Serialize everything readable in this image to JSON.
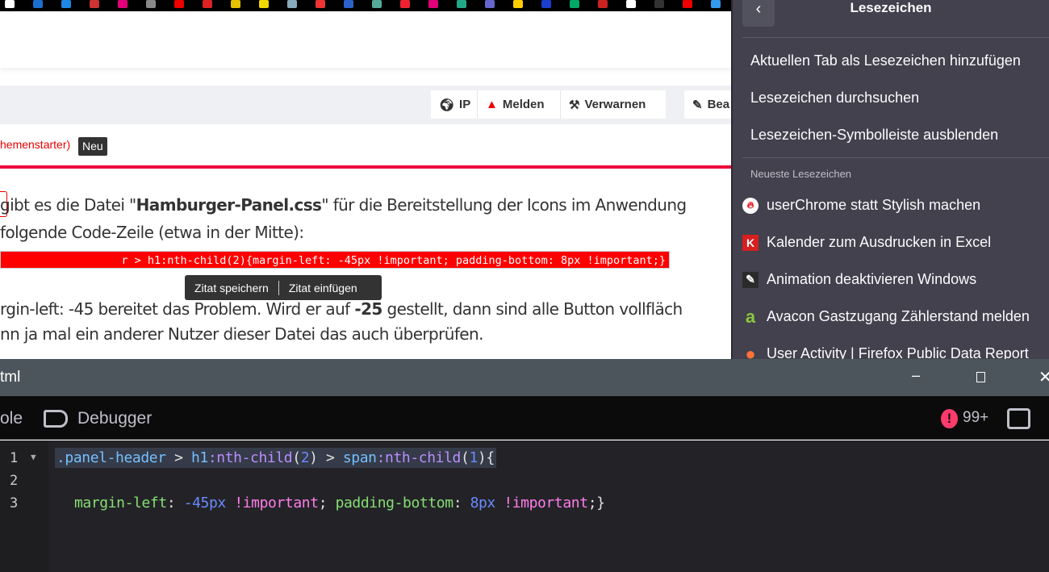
{
  "bookmark_icon_colors": [
    "#fff",
    "#1b6fd1",
    "#1e88e5",
    "#c33",
    "#e2007a",
    "#888",
    "#e00",
    "#d22",
    "#e5c100",
    "#f2d900",
    "#8ab",
    "#e33",
    "#2a62c9",
    "#5a9",
    "#e23",
    "#e2007a",
    "#2a8",
    "#66c",
    "#fc0",
    "#1a3fd0",
    "#0a6",
    "#c22",
    "#fff",
    "#333",
    "#e00",
    "#39e"
  ],
  "actions": {
    "ip": "IP",
    "report": "Melden",
    "warn": "Verwarnen",
    "edit": "Bea"
  },
  "post": {
    "author_suffix": "hemenstarter)",
    "badge": "Neu",
    "line1_pre": " gibt es die Datei \"",
    "line1_bold": "Hamburger-Panel.css",
    "line1_post": "\" für die Bereitstellung der Icons im Anwendung",
    "line2": " folgende Code-Zeile (etwa in der Mitte):",
    "code": "r > h1:nth-child(2){margin-left: -45px !important; padding-bottom: 8px !important;}",
    "line3_pre": "rgin-left: -45 bereitet das Problem. Wird er auf ",
    "line3_bold": "-25",
    "line3_post": " gestellt, dann sind alle Button vollfläch",
    "line4": "nn ja mal ein anderer Nutzer dieser Datei das auch überprüfen."
  },
  "quote_tooltip": {
    "save": "Zitat speichern",
    "insert": "Zitat einfügen"
  },
  "bookmarks_panel": {
    "title": "Lesezeichen",
    "back": "‹",
    "actions": [
      "Aktuellen Tab als Lesezeichen hinzufügen",
      "Lesezeichen durchsuchen",
      "Lesezeichen-Symbolleiste ausblenden"
    ],
    "recent_heading": "Neueste Lesezeichen",
    "recent": [
      {
        "label": "userChrome statt Stylish machen",
        "icon": "flame-icon",
        "color": "#e8202a"
      },
      {
        "label": "Kalender zum Ausdrucken in Excel",
        "icon": "k-logo-icon",
        "color": "#d71f1f"
      },
      {
        "label": "Animation deaktivieren Windows",
        "icon": "pen-icon",
        "color": "#2b2b2b"
      },
      {
        "label": "Avacon Gastzugang Zählerstand melden",
        "icon": "a-logo-icon",
        "color": "#8cc63f"
      },
      {
        "label": "User Activity | Firefox Public Data Report",
        "icon": "firefox-icon",
        "color": "#ff7139"
      }
    ]
  },
  "devtools": {
    "window_title": "tml",
    "tab_prev": "ole",
    "tab_debugger": "Debugger",
    "error_count": "99+",
    "lines": [
      "1",
      "2",
      "3"
    ],
    "code_line1": [
      ".panel-header",
      " > ",
      "h1",
      ":nth-child",
      "(",
      "2",
      ")",
      " > ",
      "span",
      ":nth-child",
      "(",
      "1",
      ")",
      "{"
    ],
    "code_line3": [
      "margin-left",
      ": ",
      "-45px",
      " ",
      "!important",
      "; ",
      "padding-bottom",
      ": ",
      "8px",
      " ",
      "!important",
      ";}"
    ]
  }
}
